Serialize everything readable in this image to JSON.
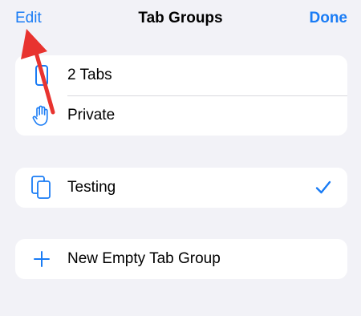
{
  "nav": {
    "edit_label": "Edit",
    "title": "Tab Groups",
    "done_label": "Done"
  },
  "sections": {
    "top": [
      {
        "label": "2 Tabs",
        "icon": "phone-tab-icon"
      },
      {
        "label": "Private",
        "icon": "hand-raised-icon"
      }
    ],
    "groups": [
      {
        "label": "Testing",
        "icon": "tab-group-icon",
        "selected": true
      }
    ],
    "actions": [
      {
        "label": "New Empty Tab Group",
        "icon": "plus-icon"
      }
    ]
  },
  "colors": {
    "accent": "#1a7cf5",
    "background": "#f2f2f7",
    "annotation_arrow": "#e8332f"
  }
}
